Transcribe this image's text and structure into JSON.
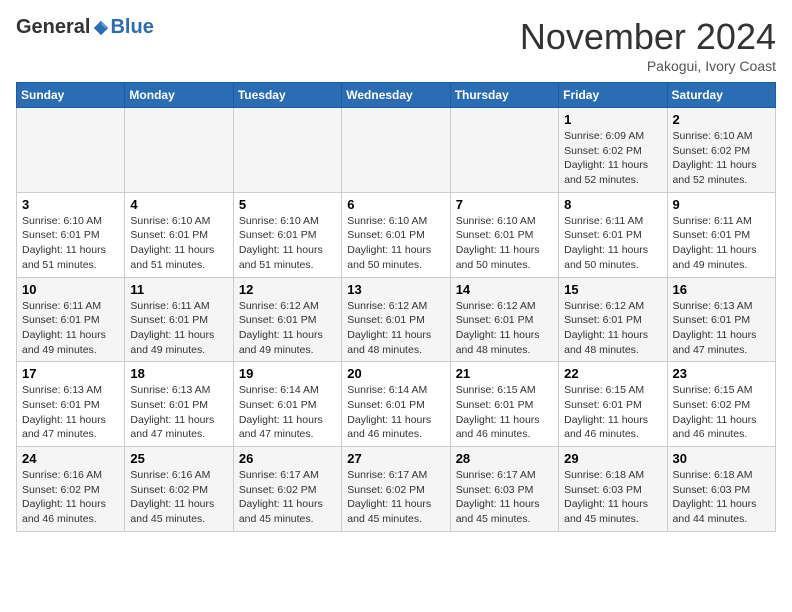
{
  "header": {
    "logo_general": "General",
    "logo_blue": "Blue",
    "month_title": "November 2024",
    "location": "Pakogui, Ivory Coast"
  },
  "days_of_week": [
    "Sunday",
    "Monday",
    "Tuesday",
    "Wednesday",
    "Thursday",
    "Friday",
    "Saturday"
  ],
  "weeks": [
    [
      {
        "day": "",
        "info": ""
      },
      {
        "day": "",
        "info": ""
      },
      {
        "day": "",
        "info": ""
      },
      {
        "day": "",
        "info": ""
      },
      {
        "day": "",
        "info": ""
      },
      {
        "day": "1",
        "info": "Sunrise: 6:09 AM\nSunset: 6:02 PM\nDaylight: 11 hours and 52 minutes."
      },
      {
        "day": "2",
        "info": "Sunrise: 6:10 AM\nSunset: 6:02 PM\nDaylight: 11 hours and 52 minutes."
      }
    ],
    [
      {
        "day": "3",
        "info": "Sunrise: 6:10 AM\nSunset: 6:01 PM\nDaylight: 11 hours and 51 minutes."
      },
      {
        "day": "4",
        "info": "Sunrise: 6:10 AM\nSunset: 6:01 PM\nDaylight: 11 hours and 51 minutes."
      },
      {
        "day": "5",
        "info": "Sunrise: 6:10 AM\nSunset: 6:01 PM\nDaylight: 11 hours and 51 minutes."
      },
      {
        "day": "6",
        "info": "Sunrise: 6:10 AM\nSunset: 6:01 PM\nDaylight: 11 hours and 50 minutes."
      },
      {
        "day": "7",
        "info": "Sunrise: 6:10 AM\nSunset: 6:01 PM\nDaylight: 11 hours and 50 minutes."
      },
      {
        "day": "8",
        "info": "Sunrise: 6:11 AM\nSunset: 6:01 PM\nDaylight: 11 hours and 50 minutes."
      },
      {
        "day": "9",
        "info": "Sunrise: 6:11 AM\nSunset: 6:01 PM\nDaylight: 11 hours and 49 minutes."
      }
    ],
    [
      {
        "day": "10",
        "info": "Sunrise: 6:11 AM\nSunset: 6:01 PM\nDaylight: 11 hours and 49 minutes."
      },
      {
        "day": "11",
        "info": "Sunrise: 6:11 AM\nSunset: 6:01 PM\nDaylight: 11 hours and 49 minutes."
      },
      {
        "day": "12",
        "info": "Sunrise: 6:12 AM\nSunset: 6:01 PM\nDaylight: 11 hours and 49 minutes."
      },
      {
        "day": "13",
        "info": "Sunrise: 6:12 AM\nSunset: 6:01 PM\nDaylight: 11 hours and 48 minutes."
      },
      {
        "day": "14",
        "info": "Sunrise: 6:12 AM\nSunset: 6:01 PM\nDaylight: 11 hours and 48 minutes."
      },
      {
        "day": "15",
        "info": "Sunrise: 6:12 AM\nSunset: 6:01 PM\nDaylight: 11 hours and 48 minutes."
      },
      {
        "day": "16",
        "info": "Sunrise: 6:13 AM\nSunset: 6:01 PM\nDaylight: 11 hours and 47 minutes."
      }
    ],
    [
      {
        "day": "17",
        "info": "Sunrise: 6:13 AM\nSunset: 6:01 PM\nDaylight: 11 hours and 47 minutes."
      },
      {
        "day": "18",
        "info": "Sunrise: 6:13 AM\nSunset: 6:01 PM\nDaylight: 11 hours and 47 minutes."
      },
      {
        "day": "19",
        "info": "Sunrise: 6:14 AM\nSunset: 6:01 PM\nDaylight: 11 hours and 47 minutes."
      },
      {
        "day": "20",
        "info": "Sunrise: 6:14 AM\nSunset: 6:01 PM\nDaylight: 11 hours and 46 minutes."
      },
      {
        "day": "21",
        "info": "Sunrise: 6:15 AM\nSunset: 6:01 PM\nDaylight: 11 hours and 46 minutes."
      },
      {
        "day": "22",
        "info": "Sunrise: 6:15 AM\nSunset: 6:01 PM\nDaylight: 11 hours and 46 minutes."
      },
      {
        "day": "23",
        "info": "Sunrise: 6:15 AM\nSunset: 6:02 PM\nDaylight: 11 hours and 46 minutes."
      }
    ],
    [
      {
        "day": "24",
        "info": "Sunrise: 6:16 AM\nSunset: 6:02 PM\nDaylight: 11 hours and 46 minutes."
      },
      {
        "day": "25",
        "info": "Sunrise: 6:16 AM\nSunset: 6:02 PM\nDaylight: 11 hours and 45 minutes."
      },
      {
        "day": "26",
        "info": "Sunrise: 6:17 AM\nSunset: 6:02 PM\nDaylight: 11 hours and 45 minutes."
      },
      {
        "day": "27",
        "info": "Sunrise: 6:17 AM\nSunset: 6:02 PM\nDaylight: 11 hours and 45 minutes."
      },
      {
        "day": "28",
        "info": "Sunrise: 6:17 AM\nSunset: 6:03 PM\nDaylight: 11 hours and 45 minutes."
      },
      {
        "day": "29",
        "info": "Sunrise: 6:18 AM\nSunset: 6:03 PM\nDaylight: 11 hours and 45 minutes."
      },
      {
        "day": "30",
        "info": "Sunrise: 6:18 AM\nSunset: 6:03 PM\nDaylight: 11 hours and 44 minutes."
      }
    ]
  ]
}
